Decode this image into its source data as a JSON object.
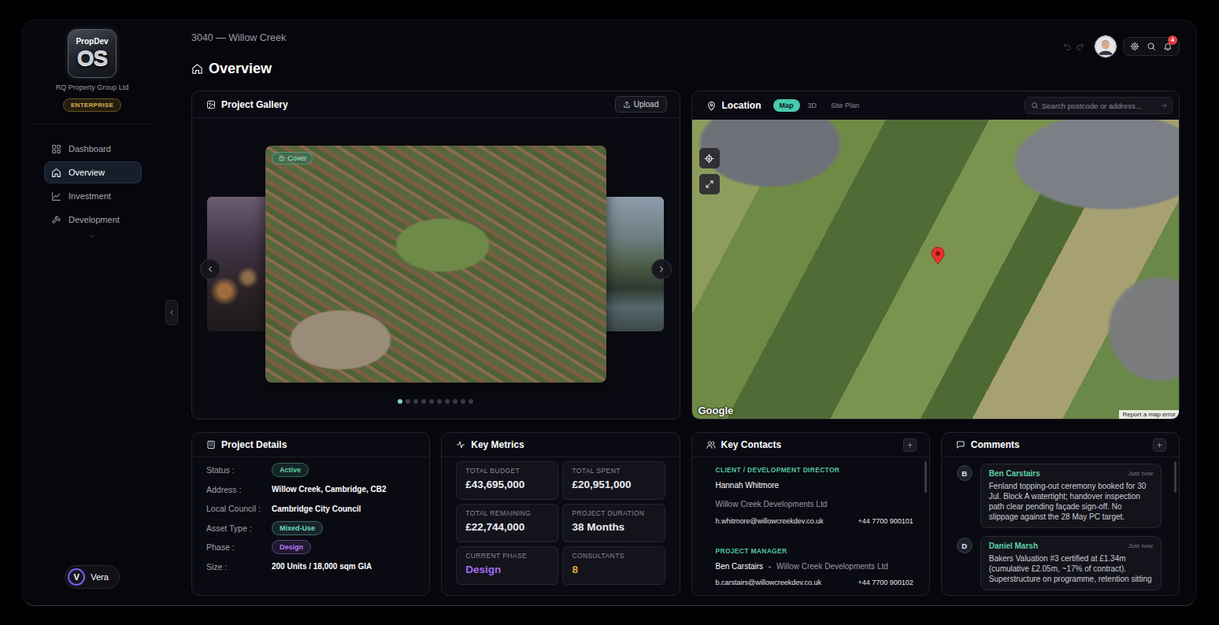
{
  "sidebar": {
    "logo_top": "PropDev",
    "logo_main": "OS",
    "company": "RQ Property Group Ltd",
    "plan": "ENTERPRISE",
    "items": [
      {
        "label": "Dashboard",
        "selected": false
      },
      {
        "label": "Overview",
        "selected": true
      },
      {
        "label": "Investment",
        "selected": false
      },
      {
        "label": "Development",
        "selected": false
      }
    ],
    "user": {
      "initial": "V",
      "name": "Vera"
    }
  },
  "header": {
    "breadcrumb": "3040 — Willow Creek",
    "title": "Overview",
    "undo": {
      "disabled": true
    },
    "redo": {
      "disabled": true
    },
    "notifications": "4"
  },
  "gallery": {
    "title": "Project Gallery",
    "upload": "Upload",
    "cover_badge": "Cover",
    "dots": [
      {
        "selected": true
      },
      {
        "selected": false
      },
      {
        "selected": false
      },
      {
        "selected": false
      },
      {
        "selected": false
      },
      {
        "selected": false
      },
      {
        "selected": false
      },
      {
        "selected": false
      },
      {
        "selected": false
      },
      {
        "selected": false
      }
    ]
  },
  "location": {
    "title": "Location",
    "tabs": [
      {
        "label": "Map",
        "selected": true
      },
      {
        "label": "3D",
        "selected": false
      },
      {
        "label": "Site Plan",
        "selected": false
      }
    ],
    "search": {
      "placeholder": "Search postcode or address..."
    },
    "attribution": "Google",
    "report": "Report a map error"
  },
  "details": {
    "title": "Project Details",
    "rows": [
      {
        "label": "Status :",
        "value": "Active",
        "kind": "badge",
        "color": "#5fd4a8"
      },
      {
        "label": "Address :",
        "value": "Willow Creek, Cambridge, CB2",
        "kind": "text"
      },
      {
        "label": "Local Council :",
        "value": "Cambridge City Council",
        "kind": "text"
      },
      {
        "label": "Asset Type :",
        "value": "Mixed-Use",
        "kind": "badge",
        "color": "#6fd6c0"
      },
      {
        "label": "Phase :",
        "value": "Design",
        "kind": "badge",
        "color": "#b57cf5"
      },
      {
        "label": "Size :",
        "value": "200 Units / 18,000 sqm GIA",
        "kind": "text"
      }
    ]
  },
  "metrics": {
    "title": "Key Metrics",
    "items": [
      {
        "label": "TOTAL BUDGET",
        "value": "£43,695,000",
        "color": "#ececf2"
      },
      {
        "label": "TOTAL SPENT",
        "value": "£20,951,000",
        "color": "#ececf2"
      },
      {
        "label": "TOTAL REMAINING",
        "value": "£22,744,000",
        "color": "#ececf2"
      },
      {
        "label": "PROJECT DURATION",
        "value": "38 Months",
        "color": "#ececf2"
      },
      {
        "label": "CURRENT PHASE",
        "value": "Design",
        "color": "#a46cf0"
      },
      {
        "label": "CONSULTANTS",
        "value": "8",
        "color": "#e0a93a"
      }
    ]
  },
  "contacts": {
    "title": "Key Contacts",
    "items": [
      {
        "kind": "stacked",
        "role": "CLIENT / DEVELOPMENT DIRECTOR",
        "name": "Hannah Whitmore",
        "company": "Willow Creek Developments Ltd",
        "email": "h.whitmore@willowcreekdev.co.uk",
        "phone": "+44 7700 900101"
      },
      {
        "kind": "inline",
        "role": "PROJECT MANAGER",
        "name": "Ben Carstairs",
        "company": "Willow Creek Developments Ltd",
        "email": "b.carstairs@willowcreekdev.co.uk",
        "phone": "+44 7700 900102"
      }
    ]
  },
  "comments": {
    "title": "Comments",
    "items": [
      {
        "initial": "B",
        "author": "Ben Carstairs",
        "time": "Just now",
        "text": "Fenland topping-out ceremony booked for 30 Jul. Block A watertight; handover inspection path clear pending façade sign-off. No slippage against the 28 May PC target."
      },
      {
        "initial": "D",
        "author": "Daniel Marsh",
        "time": "Just now",
        "text": "Bakers Valuation #3 certified at £1.34m (cumulative £2.05m, ~17% of contract). Superstructure on programme, retention sitting"
      }
    ]
  }
}
